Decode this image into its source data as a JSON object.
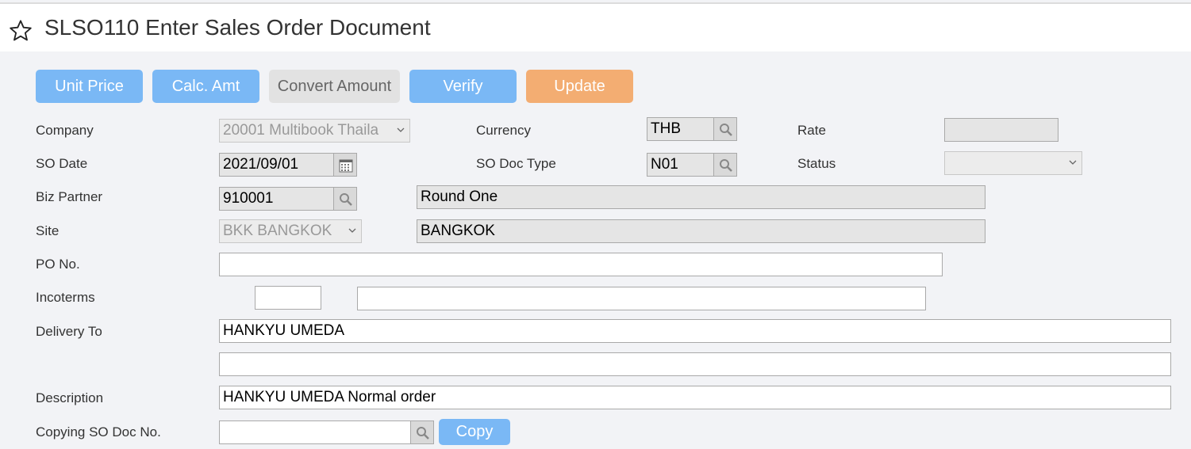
{
  "page": {
    "title": "SLSO110 Enter Sales Order Document"
  },
  "toolbar": {
    "unit_price": "Unit Price",
    "calc_amt": "Calc. Amt",
    "convert_amount": "Convert Amount",
    "verify": "Verify",
    "update": "Update"
  },
  "form": {
    "company": {
      "label": "Company",
      "value": "20001 Multibook Thaila"
    },
    "currency": {
      "label": "Currency",
      "value": "THB"
    },
    "rate": {
      "label": "Rate",
      "value": ""
    },
    "so_date": {
      "label": "SO Date",
      "value": "2021/09/01"
    },
    "so_doc_type": {
      "label": "SO Doc Type",
      "value": "N01"
    },
    "status": {
      "label": "Status",
      "value": ""
    },
    "biz_partner": {
      "label": "Biz Partner",
      "code": "910001",
      "name": "Round One"
    },
    "site": {
      "label": "Site",
      "value": "BKK BANGKOK",
      "name": "BANGKOK"
    },
    "po_no": {
      "label": "PO No.",
      "value": ""
    },
    "incoterms": {
      "label": "Incoterms",
      "code": "",
      "desc": ""
    },
    "delivery_to": {
      "label": "Delivery To",
      "line1": "HANKYU UMEDA",
      "line2": ""
    },
    "description": {
      "label": "Description",
      "value": "HANKYU UMEDA Normal order"
    },
    "copying_so_doc_no": {
      "label": "Copying SO Doc No.",
      "value": "",
      "copy_label": "Copy"
    }
  },
  "colors": {
    "accent_blue": "#7ab8f5",
    "update_orange": "#f3ad72",
    "background": "#f2f3f6"
  }
}
